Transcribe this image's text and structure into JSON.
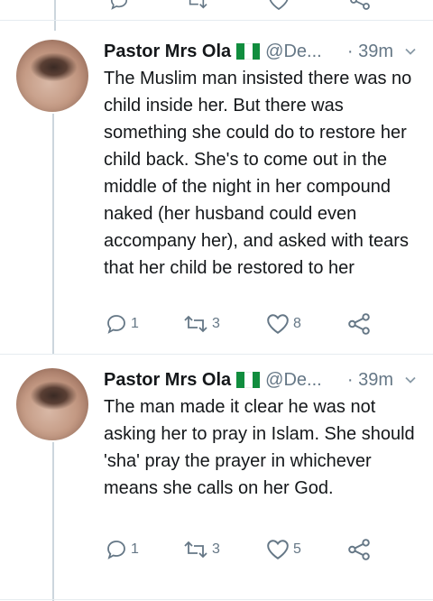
{
  "tweets": [
    {
      "name": "Pastor Mrs Ola",
      "handle": "@De...",
      "time": "· 39m",
      "text": "The Muslim man insisted there was no child inside her. But there was something she could do to restore her child back. She's to come out in the middle of the night in her compound naked (her husband could even accompany her), and asked with tears that her child be restored to her",
      "replies": "1",
      "retweets": "3",
      "likes": "8"
    },
    {
      "name": "Pastor Mrs Ola",
      "handle": "@De...",
      "time": "· 39m",
      "text": "The man made it clear he was not asking her to pray in Islam. She should 'sha' pray the prayer in whichever means she calls on her God.",
      "replies": "1",
      "retweets": "3",
      "likes": "5"
    }
  ],
  "icons": {
    "reply": "reply-icon",
    "retweet": "retweet-icon",
    "like": "heart-icon",
    "share": "share-icon",
    "caret": "chevron-down-icon",
    "flag": "nigeria-flag-icon"
  },
  "colors": {
    "muted": "#657786",
    "text": "#14171a",
    "flag_green": "#118d3e"
  }
}
